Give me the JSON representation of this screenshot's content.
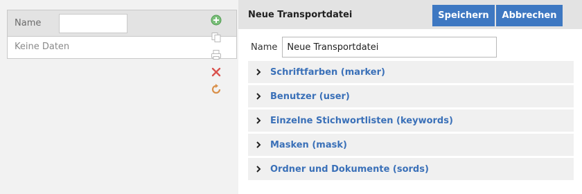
{
  "left": {
    "column_header": "Name",
    "filter_value": "",
    "empty_text": "Keine Daten"
  },
  "toolbar": {
    "icons": [
      "add-icon",
      "copy-icon",
      "print-icon",
      "delete-icon",
      "refresh-icon"
    ],
    "colors": {
      "add": "#5aa85a",
      "delete": "#d9534f",
      "refresh": "#d9904a",
      "disabled": "#b8b8b8"
    }
  },
  "editor": {
    "title": "Neue Transportdatei",
    "save_label": "Speichern",
    "cancel_label": "Abbrechen",
    "name_label": "Name",
    "name_value": "Neue Transportdatei",
    "sections": [
      {
        "label": "Schriftfarben (marker)"
      },
      {
        "label": "Benutzer (user)"
      },
      {
        "label": "Einzelne Stichwortlisten (keywords)"
      },
      {
        "label": "Masken (mask)"
      },
      {
        "label": "Ordner und Dokumente (sords)"
      }
    ]
  },
  "colors": {
    "accent": "#3e78c2",
    "link": "#3a70b8",
    "header_bg": "#e3e3e3",
    "page_bg": "#f2f2f2"
  }
}
